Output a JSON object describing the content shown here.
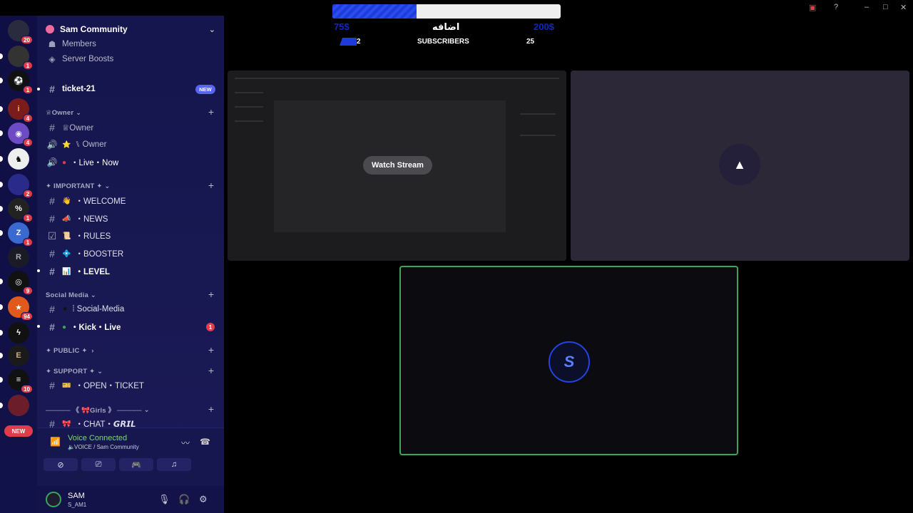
{
  "guild": {
    "name": "Sam Community"
  },
  "rail": {
    "badges": [
      "20",
      "1",
      "1",
      "4",
      "4",
      "",
      "2",
      "1",
      "1",
      "",
      "9",
      "94",
      "",
      "",
      "10"
    ],
    "new_label": "NEW"
  },
  "sidebar": {
    "members": "Members",
    "server_boosts": "Server Boosts",
    "ticket": {
      "name": "ticket-21",
      "badge": "NEW"
    },
    "cat_owner": "♕Owner",
    "owner_text": "♕Owner",
    "owner_voice": "⑊ Owner",
    "live_now": "・Live・Now",
    "cat_important": "✦ IMPORTANT ✦",
    "welcome": "・WELCOME",
    "news": "・NEWS",
    "rules": "・RULES",
    "booster": "・BOOSTER",
    "level": "・LEVEL",
    "cat_social": "Social Media",
    "social_media": "⁞ Social-Media",
    "kick_live": "・Kick・Live",
    "kick_unread": "1",
    "cat_public": "✦ PUBLIC ✦",
    "cat_support": "✦ SUPPORT ✦",
    "open_ticket": "・OPEN・TICKET",
    "cat_girls": "───── 《 🎀Girls 》 ─────",
    "chat_gril": "・CHAT・𝙂𝙍𝙄𝙇"
  },
  "voice": {
    "status": "Voice Connected",
    "channel": "VOICE / Sam Community"
  },
  "user": {
    "name": "SAM",
    "tag": "S_AM1"
  },
  "overlay": {
    "goal_title": "اضافه",
    "goal_min": "75$",
    "goal_max": "200$",
    "goal_progress": 0.37,
    "subs_current": "2",
    "subs_label": "SUBSCRIBERS",
    "subs_goal": "25"
  },
  "stage": {
    "watch_stream": "Watch Stream"
  },
  "colors": {
    "accent": "#5865f2",
    "connected": "#3ba55d",
    "danger": "#e03d4a",
    "goal_fill": "#1d3cd8"
  }
}
